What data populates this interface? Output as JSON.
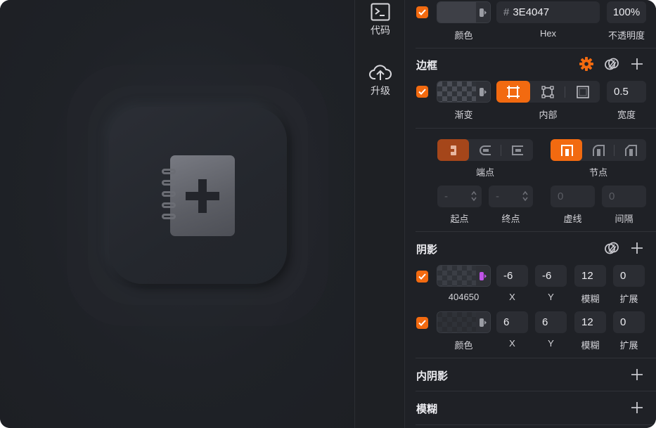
{
  "toolbar": {
    "code_label": "代码",
    "upgrade_label": "升级"
  },
  "fill": {
    "enabled": true,
    "hex": "3E4047",
    "hex_prefix": "#",
    "opacity": "100%",
    "color_caption": "颜色",
    "hex_caption": "Hex",
    "opacity_caption": "不透明度",
    "swatch_color": "#3e4047"
  },
  "border": {
    "title": "边框",
    "enabled": true,
    "type_caption": "渐变",
    "position_caption": "内部",
    "width_value": "0.5",
    "width_caption": "宽度",
    "position_options": [
      "inside",
      "center",
      "outside"
    ],
    "selected_position": "inside"
  },
  "path": {
    "endpoint_caption": "端点",
    "node_caption": "节点",
    "start_caption": "起点",
    "end_caption": "终点",
    "dash_caption": "虚线",
    "gap_caption": "间隔",
    "start_value": "-",
    "end_value": "-",
    "dash_value": "0",
    "gap_value": "0"
  },
  "shadow": {
    "title": "阴影",
    "items": [
      {
        "enabled": true,
        "color_caption": "404650",
        "x": "-6",
        "y": "-6",
        "blur": "12",
        "spread": "0",
        "tab_color": "#c052e8"
      },
      {
        "enabled": true,
        "color_caption": "颜色",
        "x": "6",
        "y": "6",
        "blur": "12",
        "spread": "0",
        "tab_color": "#9a9ca3"
      }
    ],
    "x_caption": "X",
    "y_caption": "Y",
    "blur_caption": "模糊",
    "spread_caption": "扩展"
  },
  "inner_shadow": {
    "title": "内阴影"
  },
  "blur": {
    "title": "模糊"
  },
  "colors": {
    "accent": "#f26a10",
    "panel_bg": "#1f2126",
    "field_bg": "#2b2d33"
  }
}
